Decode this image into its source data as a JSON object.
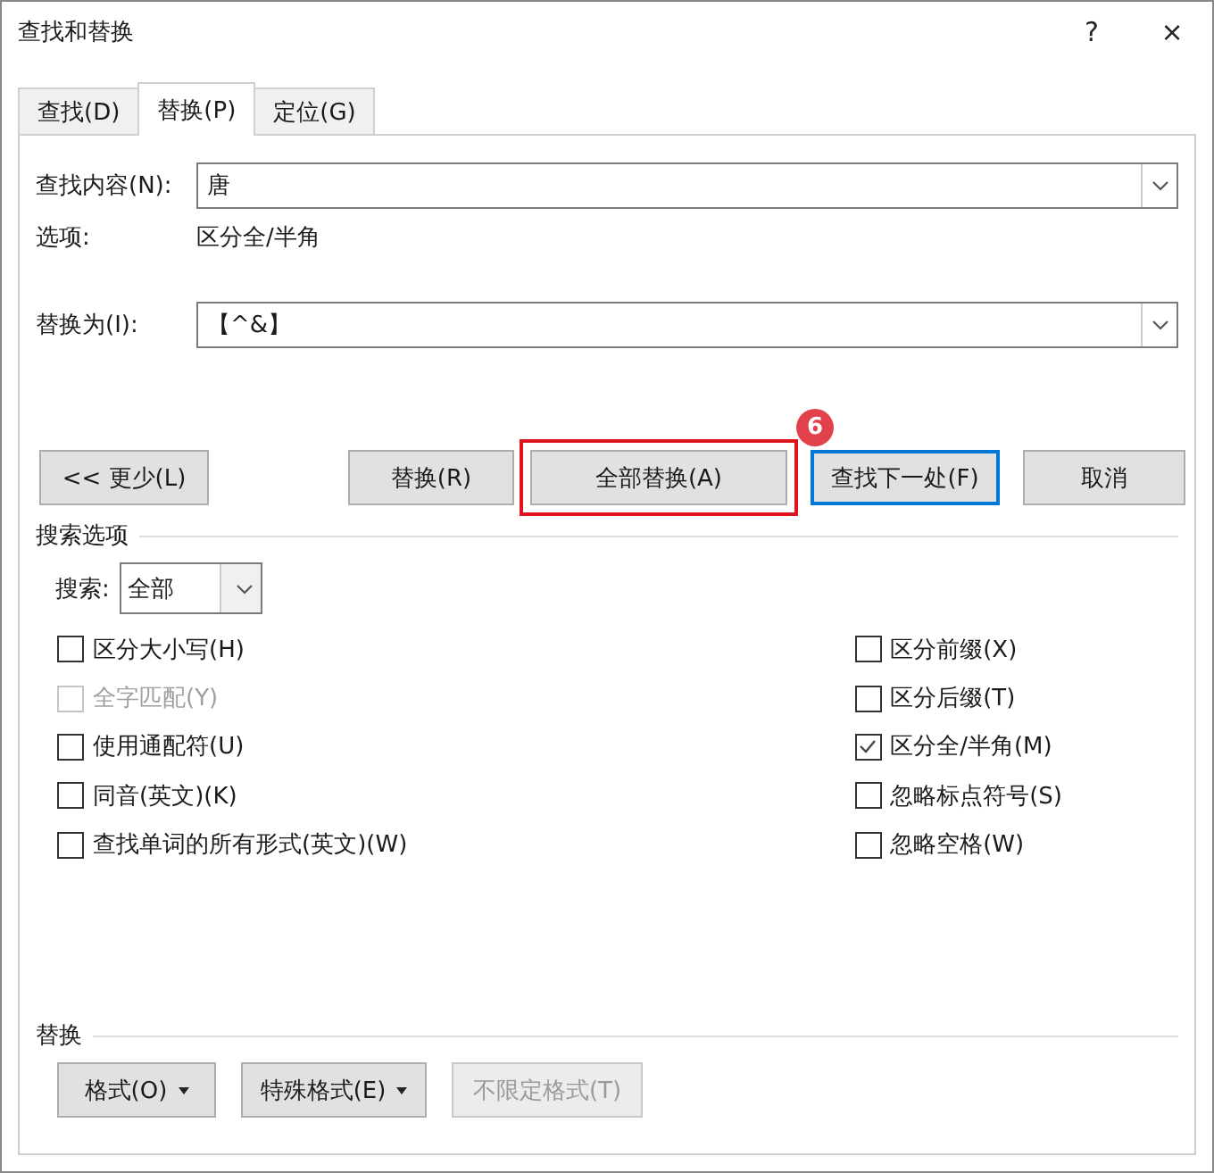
{
  "window": {
    "title": "查找和替换",
    "help": "?",
    "close": "×"
  },
  "tabs": [
    {
      "label": "查找(D)",
      "selected": false
    },
    {
      "label": "替换(P)",
      "selected": true
    },
    {
      "label": "定位(G)",
      "selected": false
    }
  ],
  "find": {
    "label": "查找内容(N):",
    "value": "唐"
  },
  "options": {
    "label": "选项:",
    "value": "区分全/半角"
  },
  "replace": {
    "label": "替换为(I):",
    "value": "【^&】"
  },
  "buttons": [
    {
      "label": "<< 更少(L)",
      "default": false,
      "highlighted": false
    },
    {
      "label": "替换(R)",
      "default": false,
      "highlighted": false
    },
    {
      "label": "全部替换(A)",
      "default": false,
      "highlighted": true
    },
    {
      "label": "查找下一处(F)",
      "default": true,
      "highlighted": false
    },
    {
      "label": "取消",
      "default": false,
      "highlighted": false
    }
  ],
  "step_badge": "6",
  "search_options": {
    "title": "搜索选项",
    "search_label": "搜索:",
    "search_value": "全部",
    "left": [
      {
        "label": "区分大小写(H)",
        "checked": false,
        "disabled": false
      },
      {
        "label": "全字匹配(Y)",
        "checked": false,
        "disabled": true
      },
      {
        "label": "使用通配符(U)",
        "checked": false,
        "disabled": false
      },
      {
        "label": "同音(英文)(K)",
        "checked": false,
        "disabled": false
      },
      {
        "label": "查找单词的所有形式(英文)(W)",
        "checked": false,
        "disabled": false
      }
    ],
    "right": [
      {
        "label": "区分前缀(X)",
        "checked": false,
        "disabled": false
      },
      {
        "label": "区分后缀(T)",
        "checked": false,
        "disabled": false
      },
      {
        "label": "区分全/半角(M)",
        "checked": true,
        "disabled": false
      },
      {
        "label": "忽略标点符号(S)",
        "checked": false,
        "disabled": false
      },
      {
        "label": "忽略空格(W)",
        "checked": false,
        "disabled": false
      }
    ]
  },
  "replace_section": {
    "title": "替换",
    "buttons": [
      {
        "label": "格式(O)",
        "dropdown": true,
        "disabled": false
      },
      {
        "label": "特殊格式(E)",
        "dropdown": true,
        "disabled": false
      },
      {
        "label": "不限定格式(T)",
        "dropdown": false,
        "disabled": true
      }
    ]
  }
}
